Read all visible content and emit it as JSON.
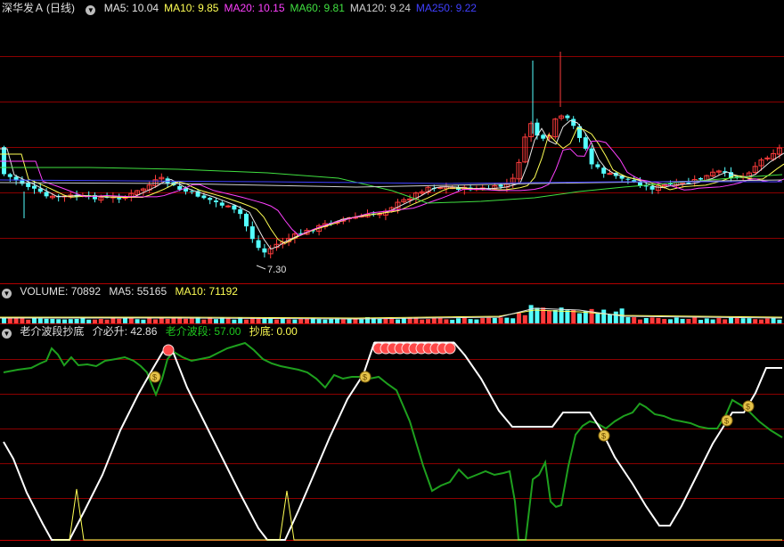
{
  "main": {
    "stock_name": "深华发Ａ",
    "period": "(日线)",
    "ma": [
      {
        "label": "MA5: 10.04",
        "color": "#e6e6e6"
      },
      {
        "label": "MA10: 9.85",
        "color": "#ffff54"
      },
      {
        "label": "MA20: 10.15",
        "color": "#ff40ff"
      },
      {
        "label": "MA60: 9.81",
        "color": "#40e040"
      },
      {
        "label": "MA120: 9.24",
        "color": "#d0d0d0"
      },
      {
        "label": "MA250: 9.22",
        "color": "#4040ff"
      }
    ],
    "low_marker": "7.30"
  },
  "volume": {
    "label": "VOLUME: 70892",
    "ma5": "MA5: 55165",
    "ma10": "MA10: 71192"
  },
  "indicator": {
    "name": "老介波段抄底",
    "jbs": "介必升: 42.86",
    "ljbd": "老介波段: 57.00",
    "cd": "抄底: 0.00"
  },
  "colors": {
    "up": "#ff3c3c",
    "down": "#54ffff",
    "grid": "#8b0000",
    "green_line": "#1ea01e",
    "white_line": "#ffffff",
    "yellow_line": "#ffff54"
  },
  "icons": {
    "toggle": "chevron-down-icon",
    "money": "money-bag-icon",
    "peak": "red-ball-icon"
  }
}
